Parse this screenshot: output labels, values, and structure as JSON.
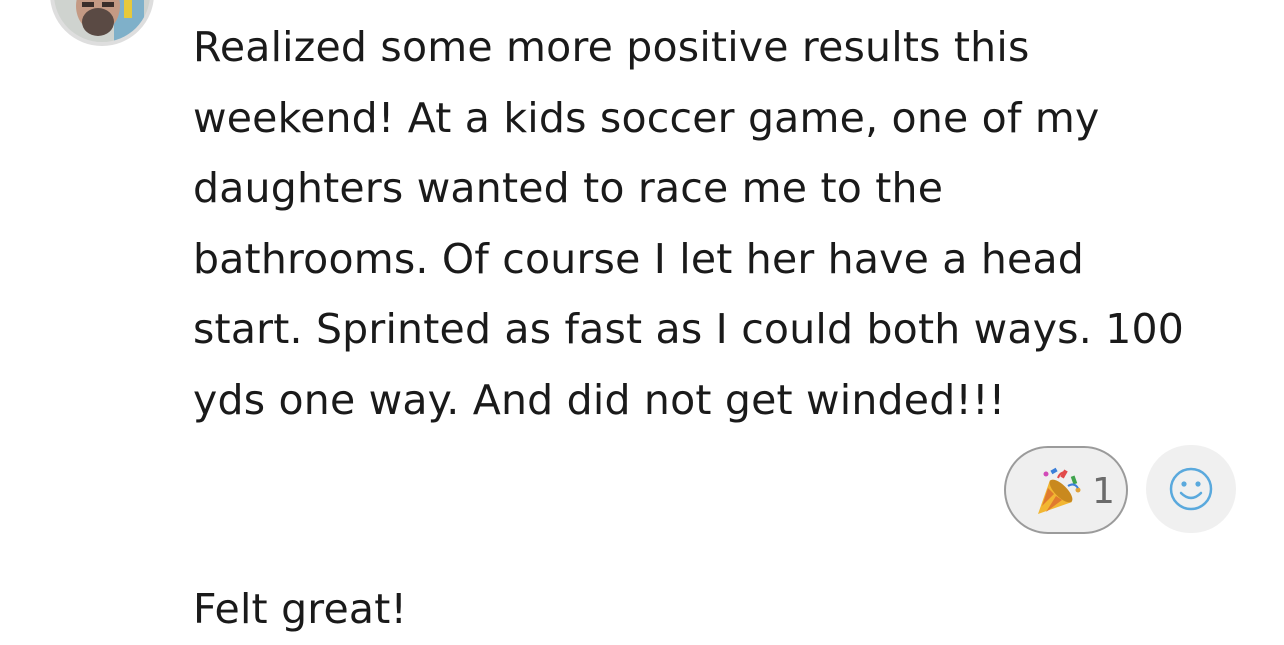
{
  "post": {
    "lines": [
      "Realized some more positive results this",
      "weekend! At a kids soccer game, one of my",
      "daughters wanted to race me to the",
      "bathrooms. Of course I let her have a head",
      "start. Sprinted as fast as I could both ways. 100",
      "yds one way. And did not get winded!!!"
    ]
  },
  "reactions": {
    "party_count": "1",
    "party_icon": "party-popper-icon",
    "add_icon": "smiley-face-icon"
  },
  "followup": {
    "text": "Felt great!"
  },
  "colors": {
    "text": "#1a1a1a",
    "pill_border": "#9b9b9b",
    "pill_bg": "#efefef",
    "smiley_blue": "#5aa9dd"
  }
}
